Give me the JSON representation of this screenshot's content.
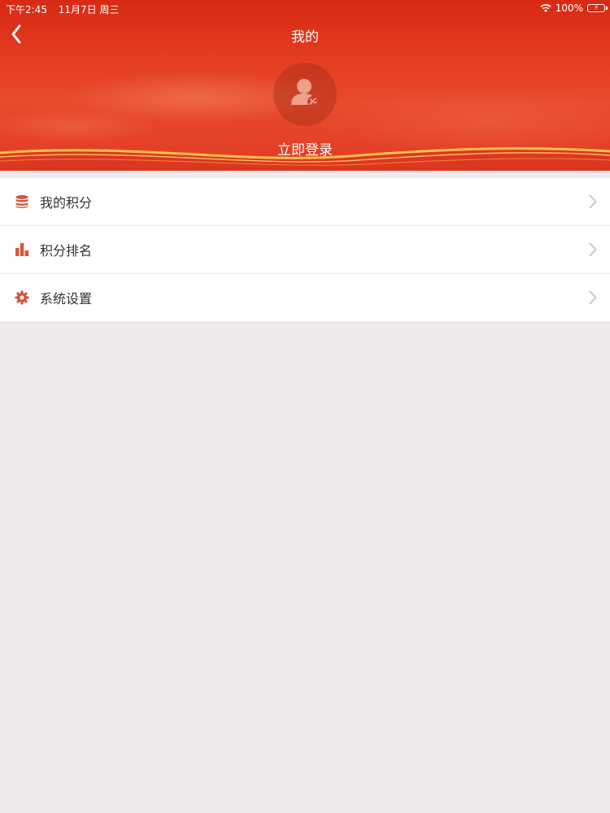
{
  "status_bar": {
    "time": "下午2:45",
    "date": "11月7日 周三",
    "battery": "100%"
  },
  "nav": {
    "title": "我的",
    "back_icon": "chevron-left-icon"
  },
  "profile": {
    "avatar_icon": "user-party-badge-icon",
    "login_label": "立即登录"
  },
  "menu": {
    "items": [
      {
        "label": "我的积分",
        "icon": "database-icon"
      },
      {
        "label": "积分排名",
        "icon": "bar-chart-icon"
      },
      {
        "label": "系统设置",
        "icon": "gear-icon"
      }
    ]
  },
  "colors": {
    "header_red": "#e23a1f",
    "accent_red": "#d9533f",
    "page_background": "#f1eaec"
  }
}
